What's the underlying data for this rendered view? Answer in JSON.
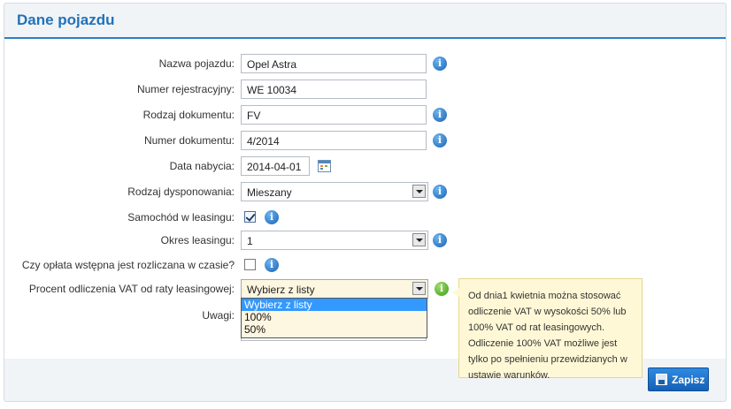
{
  "panel": {
    "title": "Dane pojazdu"
  },
  "form": {
    "vehicle_name": {
      "label": "Nazwa pojazdu:",
      "value": "Opel Astra"
    },
    "registration": {
      "label": "Numer rejestracyjny:",
      "value": "WE 10034"
    },
    "doc_type": {
      "label": "Rodzaj dokumentu:",
      "value": "FV"
    },
    "doc_number": {
      "label": "Numer dokumentu:",
      "value": "4/2014"
    },
    "purchase_date": {
      "label": "Data nabycia:",
      "value": "2014-04-01"
    },
    "disposal_type": {
      "label": "Rodzaj dysponowania:",
      "value": "Mieszany"
    },
    "leasing": {
      "label": "Samochód w leasingu:",
      "checked": true
    },
    "leasing_period": {
      "label": "Okres leasingu:",
      "value": "1"
    },
    "initial_fee": {
      "label": "Czy opłata wstępna jest rozliczana w czasie?",
      "checked": false
    },
    "vat_percent": {
      "label": "Procent odliczenia VAT od raty leasingowej:",
      "value": "Wybierz z listy",
      "options": [
        "Wybierz z listy",
        "100%",
        "50%"
      ],
      "highlighted_index": 0
    },
    "notes": {
      "label": "Uwagi:",
      "value": ""
    }
  },
  "tooltip": {
    "text": "Od dnia1 kwietnia można stosować odliczenie VAT w wysokości 50% lub 100% VAT od rat leasingowych. Odliczenie 100% VAT możliwe jest tylko po spełnieniu przewidzianych w ustawie warunków."
  },
  "actions": {
    "save_label": "Zapisz"
  },
  "icons": {
    "info": "info-icon",
    "calendar": "calendar-icon",
    "save": "save-icon"
  },
  "colors": {
    "accent": "#2272b9",
    "button": "#1f77d0",
    "tooltip_bg": "#fff8d6",
    "selection": "#3399ff"
  }
}
